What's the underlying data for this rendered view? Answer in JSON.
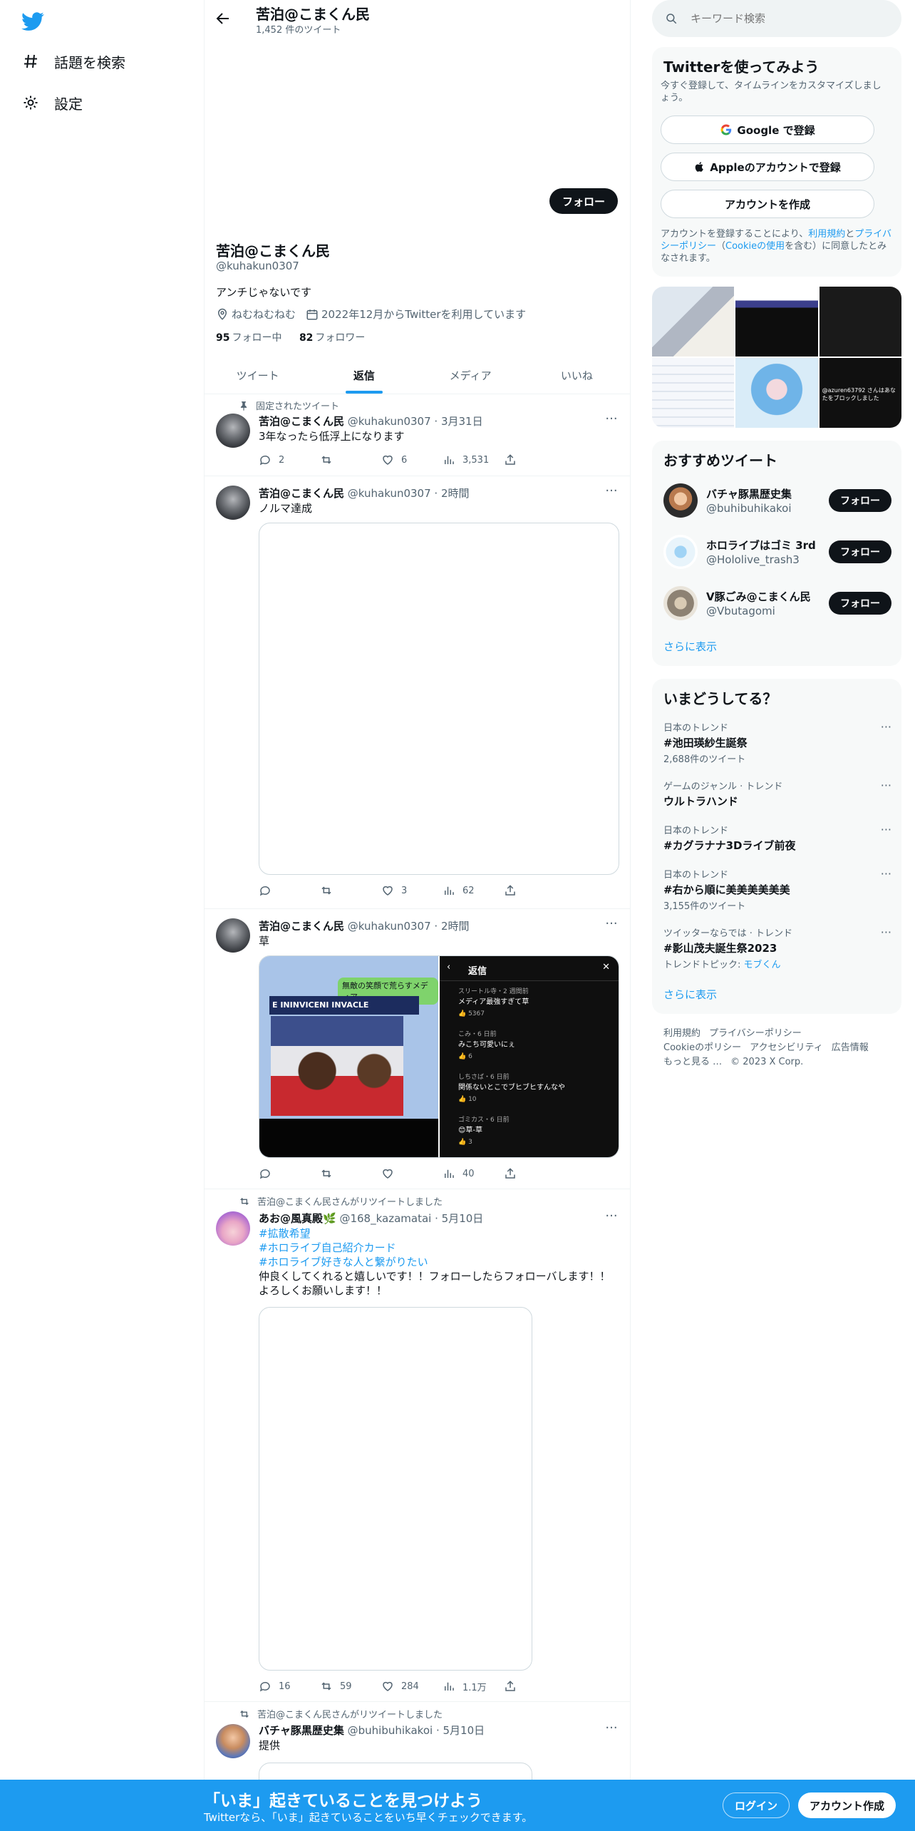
{
  "nav": {
    "items": [
      {
        "label": "話題を検索",
        "icon": "hashtag-icon"
      },
      {
        "label": "設定",
        "icon": "gear-icon"
      }
    ]
  },
  "header": {
    "title": "苦泊@こまくん民",
    "subtitle": "1,452 件のツイート"
  },
  "profile": {
    "follow_label": "フォロー",
    "name": "苦泊@こまくん民",
    "handle": "@kuhakun0307",
    "bio": "アンチじゃないです",
    "location": "ねむねむねむ",
    "joined": "2022年12月からTwitterを利用しています",
    "following_count": "95",
    "following_label": "フォロー中",
    "followers_count": "82",
    "followers_label": "フォロワー"
  },
  "tabs": [
    "ツイート",
    "返信",
    "メディア",
    "いいね"
  ],
  "tweets": [
    {
      "context": "固定されたツイート",
      "name": "苦泊@こまくん民",
      "handle": "@kuhakun0307",
      "time": "3月31日",
      "text": "3年なったら低浮上になります",
      "replies": "2",
      "retweets": "",
      "likes": "6",
      "views": "3,531"
    },
    {
      "name": "苦泊@こまくん民",
      "handle": "@kuhakun0307",
      "time": "2時間",
      "text": "ノルマ達成",
      "replies": "",
      "retweets": "",
      "likes": "3",
      "views": "62"
    },
    {
      "name": "苦泊@こまくん民",
      "handle": "@kuhakun0307",
      "time": "2時間",
      "text": "草",
      "replies": "",
      "retweets": "",
      "likes": "",
      "views": "40",
      "media_left": {
        "bubble": "無敵の笑顔で荒らすメディア",
        "banner": "E ININVICENI INVACLE"
      },
      "media_right": {
        "title": "返信",
        "comments": [
          {
            "user": "スリートル寺・2 週間前",
            "text": "メディア最強すぎて草",
            "likes": "5367"
          },
          {
            "user": "こみ・6 日前",
            "text": "みこち可愛いにぇ",
            "likes": "6"
          },
          {
            "user": "しちさば・6 日前",
            "text": "関係ないとこでブヒブヒすんなや",
            "likes": "10"
          },
          {
            "user": "ゴミカス・6 日前",
            "text": "😊草-草",
            "likes": "3"
          }
        ]
      }
    },
    {
      "context": "苦泊@こまくん民さんがリツイートしました",
      "name": "あお@風真殿🌿",
      "handle": "@168_kazamatai",
      "time": "5月10日",
      "hashtags": [
        "#拡散希望",
        "#ホロライブ自己紹介カード",
        "#ホロライブ好きな人と繋がりたい"
      ],
      "text1": "仲良くしてくれると嬉しいです！！フォローしたらフォローバします！！",
      "text2": "よろしくお願いします！！",
      "replies": "16",
      "retweets": "59",
      "likes": "284",
      "views": "1.1万"
    },
    {
      "context": "苦泊@こまくん民さんがリツイートしました",
      "name": "バチャ豚黒歴史集",
      "handle": "@buhibuhikakoi",
      "time": "5月10日",
      "text": "提供"
    }
  ],
  "search": {
    "placeholder": "キーワード検索"
  },
  "signup_card": {
    "title": "Twitterを使ってみよう",
    "desc": "今すぐ登録して、タイムラインをカスタマイズしましょう。",
    "google": "Google で登録",
    "apple": "Appleのアカウントで登録",
    "create": "アカウントを作成",
    "terms_pre": "アカウントを登録することにより、",
    "terms_link1": "利用規約",
    "terms_mid": "と",
    "terms_link2": "プライバシーポリシー",
    "terms_paren_open": "（",
    "terms_link3": "Cookieの使用",
    "terms_post": "を含む）に同意したとみなされます。"
  },
  "gallery": {
    "caption": "@azuren63792 さんはあなたをブロックしました"
  },
  "recommend": {
    "title": "おすすめツイート",
    "accounts": [
      {
        "name": "バチャ豚黒歴史集",
        "handle": "@buhibuhikakoi"
      },
      {
        "name": "ホロライブはゴミ 3rd",
        "handle": "@Hololive_trash3"
      },
      {
        "name": "V豚ごみ@こまくん民",
        "handle": "@Vbutagomi"
      }
    ],
    "follow_label": "フォロー",
    "more": "さらに表示"
  },
  "trends": {
    "title": "いまどうしてる？",
    "items": [
      {
        "context": "日本のトレンド",
        "topic": "#池田瑛紗生誕祭",
        "count": "2,688件のツイート"
      },
      {
        "context": "ゲームのジャンル · トレンド",
        "topic": "ウルトラハンド",
        "count": ""
      },
      {
        "context": "日本のトレンド",
        "topic": "#カグラナナ3Dライブ前夜",
        "count": ""
      },
      {
        "context": "日本のトレンド",
        "topic": "#右から順に美美美美美美",
        "count": "3,155件のツイート"
      },
      {
        "context": "ツイッターならでは · トレンド",
        "topic": "#影山茂夫誕生祭2023",
        "count_pre": "トレンドトピック: ",
        "count_link": "モブくん"
      }
    ],
    "more": "さらに表示"
  },
  "footer": {
    "links": [
      "利用規約",
      "プライバシーポリシー",
      "Cookieのポリシー",
      "アクセシビリティ",
      "広告情報",
      "もっと見る …",
      "© 2023 X Corp."
    ]
  },
  "bottombar": {
    "title": "「いま」起きていることを見つけよう",
    "subtitle": "Twitterなら、「いま」起きていることをいち早くチェックできます。",
    "login": "ログイン",
    "signup": "アカウント作成"
  },
  "colors": {
    "accent": "#1d9bf0",
    "text": "#0f1419",
    "muted": "#536471",
    "border": "#eff3f4"
  }
}
